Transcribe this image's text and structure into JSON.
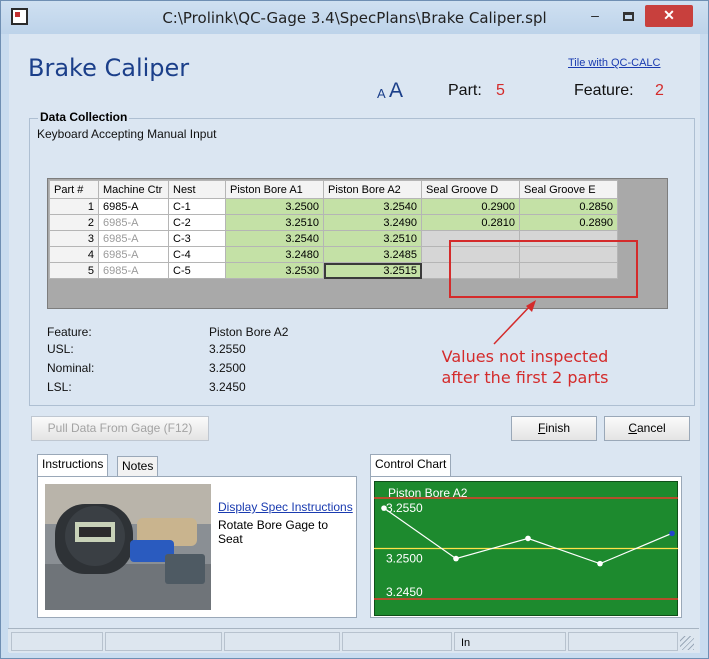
{
  "window": {
    "title": "C:\\Prolink\\QC-Gage 3.4\\SpecPlans\\Brake Caliper.spl",
    "minimize_glyph": "–",
    "close_glyph": "✕"
  },
  "header": {
    "plan_title": "Brake Caliper",
    "tile_link": "Tile with QC-CALC",
    "font_small": "A",
    "font_large": "A",
    "part_label": "Part:",
    "part_value": "5",
    "feature_label": "Feature:",
    "feature_value": "2"
  },
  "data_collection": {
    "title": "Data Collection",
    "status": "Keyboard Accepting Manual Input",
    "columns": [
      "Part #",
      "Machine Ctr",
      "Nest",
      "Piston Bore A1",
      "Piston Bore A2",
      "Seal Groove D",
      "Seal Groove E"
    ],
    "rows": [
      {
        "part": "1",
        "machine": "6985-A",
        "nest": "C-1",
        "a1": "3.2500",
        "a2": "3.2540",
        "d": "0.2900",
        "e": "0.2850",
        "machine_dim": false
      },
      {
        "part": "2",
        "machine": "6985-A",
        "nest": "C-2",
        "a1": "3.2510",
        "a2": "3.2490",
        "d": "0.2810",
        "e": "0.2890",
        "machine_dim": true
      },
      {
        "part": "3",
        "machine": "6985-A",
        "nest": "C-3",
        "a1": "3.2540",
        "a2": "3.2510",
        "d": "",
        "e": "",
        "machine_dim": true
      },
      {
        "part": "4",
        "machine": "6985-A",
        "nest": "C-4",
        "a1": "3.2480",
        "a2": "3.2485",
        "d": "",
        "e": "",
        "machine_dim": true
      },
      {
        "part": "5",
        "machine": "6985-A",
        "nest": "C-5",
        "a1": "3.2530",
        "a2": "3.2515",
        "d": "",
        "e": "",
        "machine_dim": true
      }
    ]
  },
  "feature_info": {
    "feature_label": "Feature:",
    "feature_value": "Piston Bore A2",
    "usl_label": "USL:",
    "usl_value": "3.2550",
    "nominal_label": "Nominal:",
    "nominal_value": "3.2500",
    "lsl_label": "LSL:",
    "lsl_value": "3.2450"
  },
  "annotation": {
    "line1": "Values not inspected",
    "line2": "after the first 2 parts"
  },
  "buttons": {
    "pull_data": "Pull Data From Gage (F12)",
    "finish_underline": "F",
    "finish_rest": "inish",
    "cancel_underline": "C",
    "cancel_rest": "ancel"
  },
  "tabs": {
    "instructions": "Instructions",
    "notes": "Notes",
    "control_chart": "Control Chart"
  },
  "instructions": {
    "link": "Display Spec Instructions",
    "text": "Rotate Bore Gage to Seat"
  },
  "chart_data": {
    "type": "line",
    "title": "Piston Bore A2",
    "tick_labels": [
      "3.2550",
      "3.2500",
      "3.2450"
    ],
    "ylim": [
      3.2445,
      3.2555
    ],
    "usl": 3.255,
    "nominal": 3.25,
    "lsl": 3.245,
    "x": [
      1,
      2,
      3,
      4,
      5
    ],
    "values": [
      3.254,
      3.249,
      3.251,
      3.2485,
      3.2515
    ],
    "background_color": "#1d8a2e",
    "limit_color": "#e63b2a",
    "center_color": "#ffe14a",
    "line_color": "#ffffff"
  },
  "statusbar": {
    "cells": [
      "",
      "",
      "",
      "",
      "In",
      ""
    ]
  },
  "colors": {
    "accent": "#1b3f8a",
    "highlight_red": "#d42b2b",
    "measured_cell": "#c4e1a6"
  }
}
